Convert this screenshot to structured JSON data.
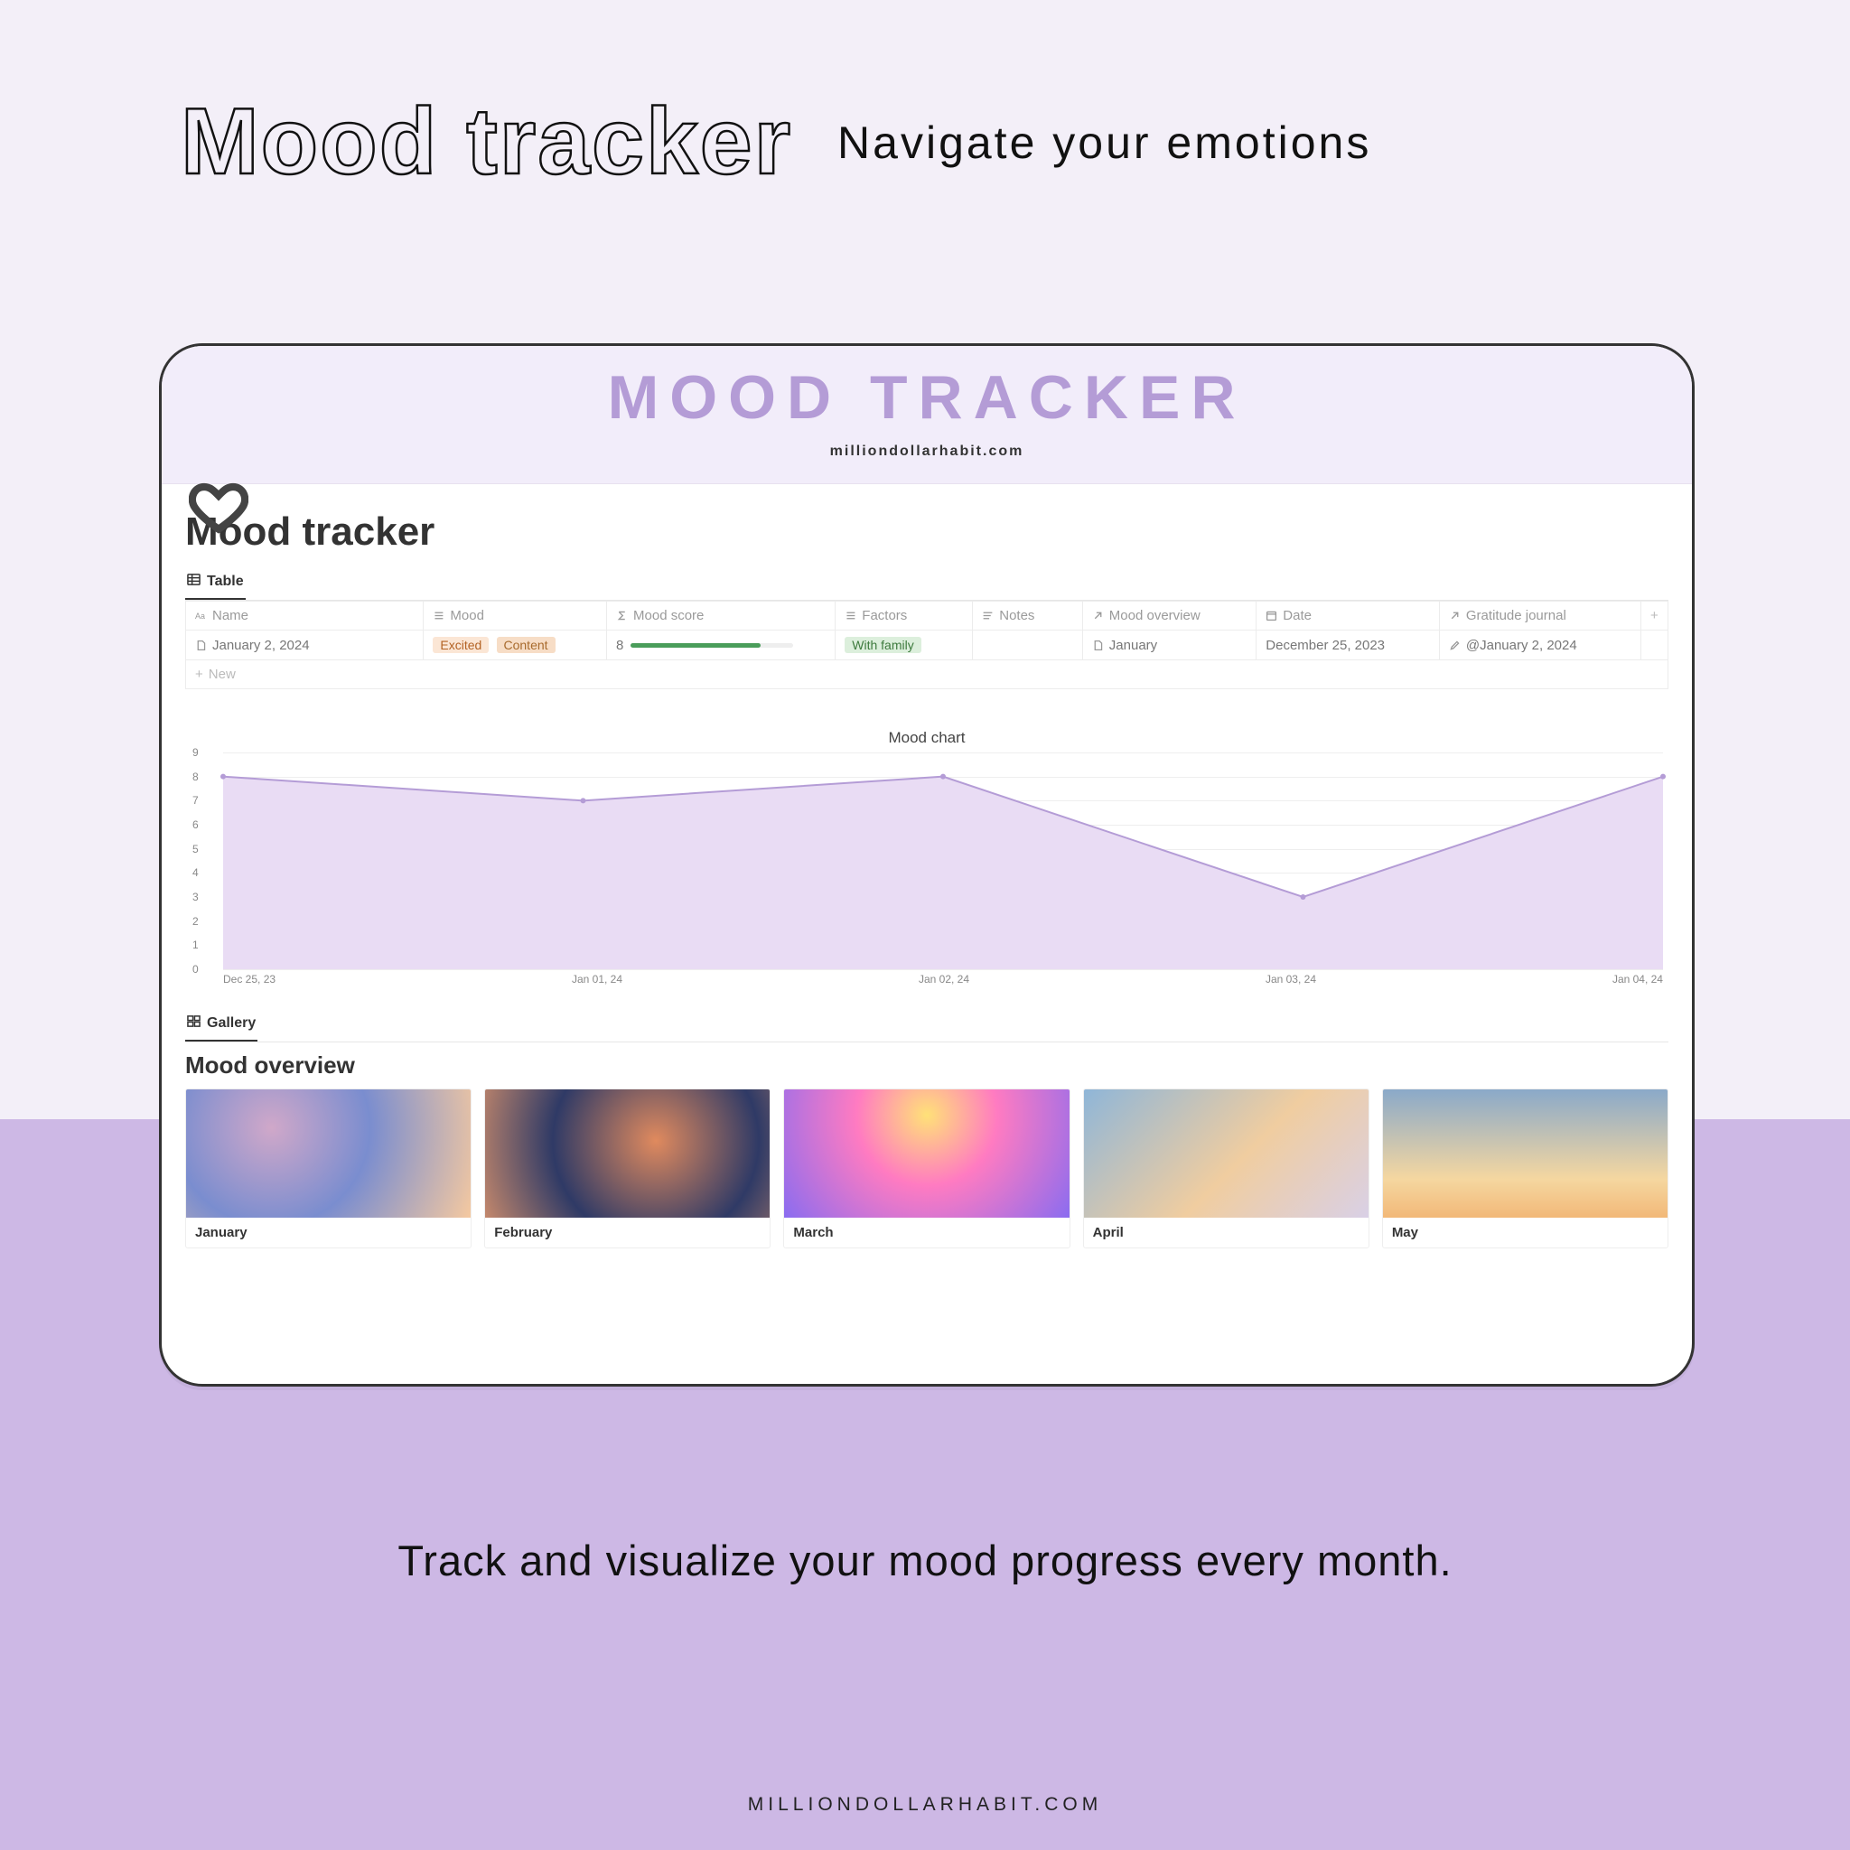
{
  "hero": {
    "title": "Mood tracker",
    "subtitle": "Navigate your emotions"
  },
  "card": {
    "brand": "MOOD TRACKER",
    "site": "milliondollarhabit.com"
  },
  "page": {
    "title": "Mood tracker",
    "tab_table": "Table",
    "tab_gallery": "Gallery",
    "overview_title": "Mood overview"
  },
  "columns": {
    "name": "Name",
    "mood": "Mood",
    "score": "Mood score",
    "factors": "Factors",
    "notes": "Notes",
    "overview": "Mood overview",
    "date": "Date",
    "gratitude": "Gratitude journal",
    "add": "+"
  },
  "row": {
    "name": "January 2, 2024",
    "mood_tags": {
      "a": "Excited",
      "b": "Content"
    },
    "score": "8",
    "score_pct": 80,
    "factors": "With family",
    "overview": "January",
    "date": "December 25, 2023",
    "gratitude": "@January 2, 2024"
  },
  "newrow": "New",
  "chart_data": {
    "type": "line",
    "title": "Mood chart",
    "xlabel": "",
    "ylabel": "",
    "ylim": [
      0,
      9
    ],
    "yticks": [
      0,
      1,
      2,
      3,
      4,
      5,
      6,
      7,
      8,
      9
    ],
    "categories": [
      "Dec 25, 23",
      "Jan 01, 24",
      "Jan 02, 24",
      "Jan 03, 24",
      "Jan 04, 24"
    ],
    "values": [
      8,
      7,
      8,
      3,
      8
    ]
  },
  "gallery": [
    {
      "label": "January"
    },
    {
      "label": "February"
    },
    {
      "label": "March"
    },
    {
      "label": "April"
    },
    {
      "label": "May"
    }
  ],
  "tagline": "Track and visualize your mood progress every month.",
  "footer": "MILLIONDOLLARHABIT.COM"
}
